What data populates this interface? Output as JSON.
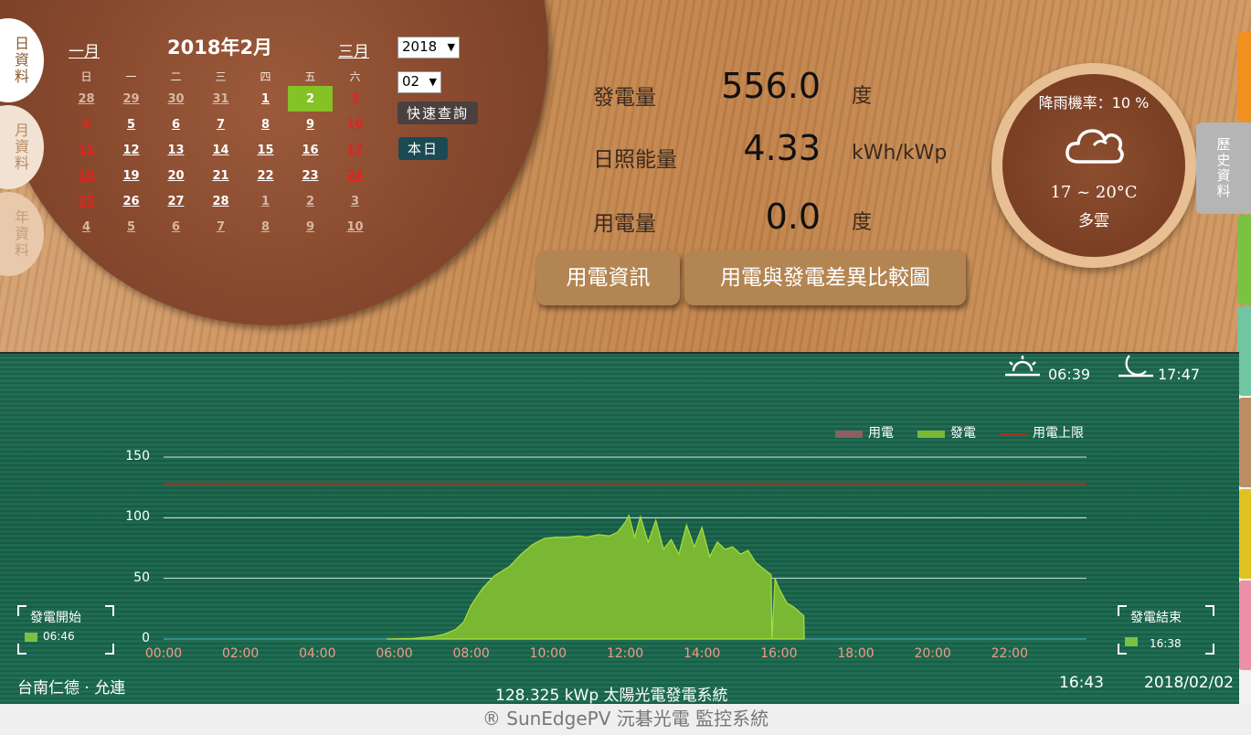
{
  "side_tabs": [
    "日資料",
    "月資料",
    "年資料"
  ],
  "calendar": {
    "prev": "一月",
    "title": "2018年2月",
    "next": "三月",
    "weekdays": [
      "日",
      "一",
      "二",
      "三",
      "四",
      "五",
      "六"
    ],
    "weeks": [
      [
        {
          "d": "28",
          "t": "o"
        },
        {
          "d": "29",
          "t": "o"
        },
        {
          "d": "30",
          "t": "o"
        },
        {
          "d": "31",
          "t": "o"
        },
        {
          "d": "1",
          "t": "c"
        },
        {
          "d": "2",
          "t": "today"
        },
        {
          "d": "3",
          "t": "s"
        }
      ],
      [
        {
          "d": "4",
          "t": "s"
        },
        {
          "d": "5",
          "t": "c"
        },
        {
          "d": "6",
          "t": "c"
        },
        {
          "d": "7",
          "t": "c"
        },
        {
          "d": "8",
          "t": "c"
        },
        {
          "d": "9",
          "t": "c"
        },
        {
          "d": "10",
          "t": "s"
        }
      ],
      [
        {
          "d": "11",
          "t": "s"
        },
        {
          "d": "12",
          "t": "c"
        },
        {
          "d": "13",
          "t": "c"
        },
        {
          "d": "14",
          "t": "c"
        },
        {
          "d": "15",
          "t": "c"
        },
        {
          "d": "16",
          "t": "c"
        },
        {
          "d": "17",
          "t": "s"
        }
      ],
      [
        {
          "d": "18",
          "t": "s"
        },
        {
          "d": "19",
          "t": "c"
        },
        {
          "d": "20",
          "t": "c"
        },
        {
          "d": "21",
          "t": "c"
        },
        {
          "d": "22",
          "t": "c"
        },
        {
          "d": "23",
          "t": "c"
        },
        {
          "d": "24",
          "t": "s"
        }
      ],
      [
        {
          "d": "25",
          "t": "s"
        },
        {
          "d": "26",
          "t": "c"
        },
        {
          "d": "27",
          "t": "c"
        },
        {
          "d": "28",
          "t": "c"
        },
        {
          "d": "1",
          "t": "o"
        },
        {
          "d": "2",
          "t": "o"
        },
        {
          "d": "3",
          "t": "o"
        }
      ],
      [
        {
          "d": "4",
          "t": "o"
        },
        {
          "d": "5",
          "t": "o"
        },
        {
          "d": "6",
          "t": "o"
        },
        {
          "d": "7",
          "t": "o"
        },
        {
          "d": "8",
          "t": "o"
        },
        {
          "d": "9",
          "t": "o"
        },
        {
          "d": "10",
          "t": "o"
        }
      ]
    ]
  },
  "controls": {
    "year_select": "2018",
    "month_select": "02",
    "quick_query": "快速查詢",
    "today_button": "本日"
  },
  "stats": {
    "generation_label": "發電量",
    "generation_value": "556.0",
    "generation_unit": "度",
    "irradiance_label": "日照能量",
    "irradiance_value": "4.33",
    "irradiance_unit": "kWh/kWp",
    "consumption_label": "用電量",
    "consumption_value": "0.0",
    "consumption_unit": "度"
  },
  "buttons": {
    "usage_info": "用電資訊",
    "comparison": "用電與發電差異比較圖"
  },
  "weather": {
    "rain": "降雨機率：10 %",
    "temp": "17 ~ 20°C",
    "condition": "多雲",
    "icon": "cloud-icon"
  },
  "history_tab": "歷史資料",
  "colors": {
    "bars": [
      "#f0901e",
      "#7cc242",
      "#6fc6a0",
      "#bc8e63",
      "#dfc11f",
      "#ec8fa7"
    ]
  },
  "sun": {
    "sunrise": "06:39",
    "sunset": "17:47"
  },
  "legend": {
    "usage": "用電",
    "generation": "發電",
    "limit": "用電上限"
  },
  "start": {
    "label": "發電開始",
    "time": "06:46"
  },
  "end": {
    "label": "發電結束",
    "time": "16:38"
  },
  "location": "台南仁德 · 允連",
  "system": "128.325  kWp 太陽光電發電系統",
  "clock": "16:43",
  "date": "2018/02/02",
  "footer": "® SunEdgePV 沅碁光電 監控系統",
  "chart_data": {
    "type": "area",
    "x_ticks": [
      "00:00",
      "02:00",
      "04:00",
      "06:00",
      "08:00",
      "10:00",
      "12:00",
      "14:00",
      "16:00",
      "18:00",
      "20:00",
      "22:00"
    ],
    "y_ticks": [
      "0",
      "50",
      "100",
      "150"
    ],
    "ylim": [
      0,
      160
    ],
    "limit_line": 128,
    "series": [
      {
        "name": "發電",
        "color": "#7ab834",
        "x": [
          5.8,
          6.5,
          7.0,
          7.3,
          7.6,
          7.8,
          8.0,
          8.3,
          8.6,
          9.0,
          9.3,
          9.6,
          9.9,
          10.2,
          10.5,
          10.8,
          11.0,
          11.3,
          11.6,
          11.8,
          12.0,
          12.1,
          12.25,
          12.4,
          12.6,
          12.8,
          13.0,
          13.2,
          13.4,
          13.6,
          13.8,
          14.0,
          14.2,
          14.4,
          14.6,
          14.8,
          15.0,
          15.2,
          15.4,
          15.6,
          15.8,
          15.82,
          15.9,
          16.0,
          16.2,
          16.4,
          16.65,
          16.66
        ],
        "y": [
          0,
          0.5,
          2,
          4,
          8,
          14,
          28,
          42,
          52,
          60,
          70,
          78,
          83,
          84,
          84,
          85,
          84,
          86,
          85,
          88,
          96,
          102,
          84,
          101,
          80,
          98,
          74,
          82,
          70,
          94,
          76,
          92,
          68,
          80,
          74,
          76,
          70,
          73,
          63,
          58,
          53,
          0,
          50,
          42,
          30,
          26,
          19,
          0
        ]
      },
      {
        "name": "用電",
        "color": "#8a6060",
        "x": [],
        "y": []
      }
    ]
  }
}
